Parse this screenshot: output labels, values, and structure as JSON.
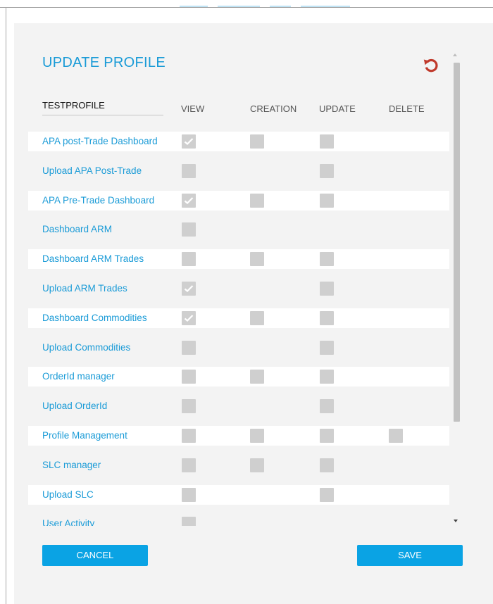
{
  "modal": {
    "title": "UPDATE PROFILE",
    "profile_name": "TESTPROFILE",
    "reset_icon": "refresh-icon",
    "accent_color": "#1a9bd7",
    "reset_color": "#c0392b"
  },
  "columns": {
    "view": "VIEW",
    "creation": "CREATION",
    "update": "UPDATE",
    "delete": "DELETE"
  },
  "rows": [
    {
      "label": "APA post-Trade Dashboard",
      "view": true,
      "creation": false,
      "update": false,
      "delete": null
    },
    {
      "label": "Upload APA Post-Trade",
      "view": false,
      "creation": null,
      "update": false,
      "delete": null
    },
    {
      "label": "APA Pre-Trade Dashboard",
      "view": true,
      "creation": false,
      "update": false,
      "delete": null
    },
    {
      "label": "Dashboard ARM",
      "view": false,
      "creation": null,
      "update": null,
      "delete": null
    },
    {
      "label": "Dashboard ARM Trades",
      "view": false,
      "creation": false,
      "update": false,
      "delete": null
    },
    {
      "label": "Upload ARM Trades",
      "view": true,
      "creation": null,
      "update": false,
      "delete": null
    },
    {
      "label": "Dashboard Commodities",
      "view": true,
      "creation": false,
      "update": false,
      "delete": null
    },
    {
      "label": "Upload Commodities",
      "view": false,
      "creation": null,
      "update": false,
      "delete": null
    },
    {
      "label": "OrderId manager",
      "view": false,
      "creation": false,
      "update": false,
      "delete": null
    },
    {
      "label": "Upload OrderId",
      "view": false,
      "creation": null,
      "update": false,
      "delete": null
    },
    {
      "label": "Profile Management",
      "view": false,
      "creation": false,
      "update": false,
      "delete": false
    },
    {
      "label": "SLC manager",
      "view": false,
      "creation": false,
      "update": false,
      "delete": null
    },
    {
      "label": "Upload SLC",
      "view": false,
      "creation": null,
      "update": false,
      "delete": null
    },
    {
      "label": "User Activity",
      "view": false,
      "creation": null,
      "update": null,
      "delete": null
    }
  ],
  "buttons": {
    "cancel": "CANCEL",
    "save": "SAVE",
    "color": "#0aa3e4"
  }
}
